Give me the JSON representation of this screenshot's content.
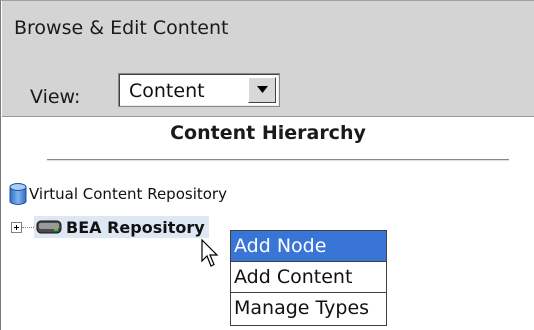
{
  "header": {
    "title": "Browse & Edit Content",
    "view_label": "View:",
    "view_value": "Content"
  },
  "hierarchy": {
    "title": "Content Hierarchy",
    "root_label": "Virtual Content Repository",
    "child_label": "BEA Repository"
  },
  "context_menu": {
    "items": [
      {
        "label": "Add Node"
      },
      {
        "label": "Add Content"
      },
      {
        "label": "Manage Types"
      }
    ],
    "active_index": 0
  },
  "colors": {
    "header_bg": "#d4d4d4",
    "menu_highlight": "#3875d7",
    "node_highlight": "#dde8f4",
    "repository_icon": "#3a7bd5"
  },
  "icons": {
    "root": "database-icon",
    "child": "repository-drive-icon",
    "expander": "plus-expander-icon",
    "dropdown": "chevron-down-icon",
    "pointer": "mouse-pointer-icon"
  }
}
